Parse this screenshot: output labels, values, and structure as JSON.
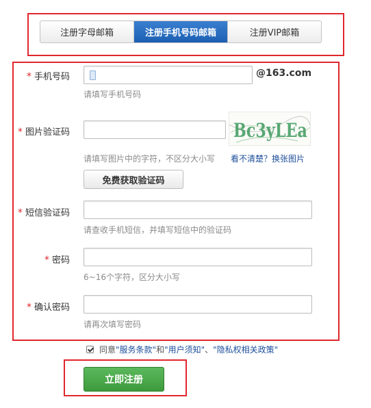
{
  "tabs": [
    {
      "label": "注册字母邮箱"
    },
    {
      "label": "注册手机号码邮箱"
    },
    {
      "label": "注册VIP邮箱"
    }
  ],
  "form": {
    "required_mark": "*",
    "phone": {
      "label": "手机号码",
      "suffix": "@163.com",
      "hint": "请填写手机号码",
      "value": ""
    },
    "captcha": {
      "label": "图片验证码",
      "hint": "请填写图片中的字符，不区分大小写",
      "refresh_link": "看不清楚？换张图片",
      "image_text": "Bc3yLEa"
    },
    "sms_button": "免费获取验证码",
    "sms": {
      "label": "短信验证码",
      "hint": "请查收手机短信，并填写短信中的验证码"
    },
    "password": {
      "label": "密码",
      "hint": "6~16个字符，区分大小写"
    },
    "confirm": {
      "label": "确认密码",
      "hint": "请再次填写密码"
    }
  },
  "agreement": {
    "prefix": "同意",
    "terms": "\"服务条款\"",
    "and": "和",
    "notice": "\"用户须知\"",
    "sep": "、",
    "privacy": "\"隐私权相关政策\"",
    "checked": true
  },
  "submit_label": "立即注册",
  "colors": {
    "highlight": "#e0262d",
    "tab_active": "#1c5fb3",
    "submit": "#3d9a3d",
    "link": "#1d4e9a"
  }
}
